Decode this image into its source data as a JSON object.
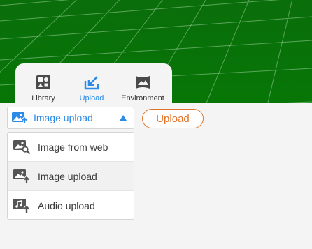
{
  "tabs": [
    {
      "label": "Library",
      "icon": "library-icon",
      "active": false
    },
    {
      "label": "Upload",
      "icon": "upload-icon",
      "active": true
    },
    {
      "label": "Environment",
      "icon": "environment-icon",
      "active": false
    }
  ],
  "upload_type_dropdown": {
    "selected_label": "Image upload",
    "selected_icon": "image-upload-icon",
    "caret_icon": "caret-up-icon",
    "options": [
      {
        "label": "Image from web",
        "icon": "image-search-icon",
        "selected": false
      },
      {
        "label": "Image upload",
        "icon": "image-upload-icon",
        "selected": true
      },
      {
        "label": "Audio upload",
        "icon": "audio-upload-icon",
        "selected": false
      }
    ]
  },
  "upload_button": {
    "label": "Upload"
  },
  "colors": {
    "accent_blue": "#2b8be6",
    "upload_orange": "#e2742a",
    "ground_green": "#0a7a0a",
    "panel_bg": "#f4f4f4",
    "icon_dark": "#444444"
  }
}
